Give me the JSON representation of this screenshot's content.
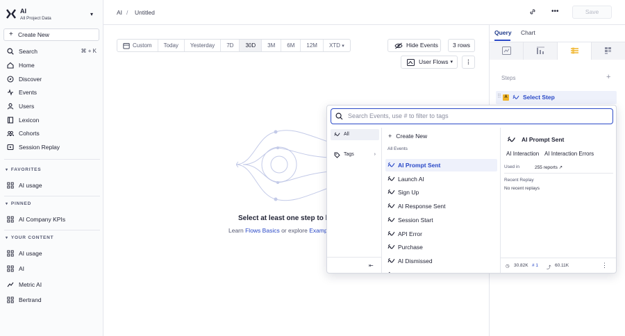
{
  "project": {
    "name": "AI",
    "subtitle": "All Project Data"
  },
  "sidebar": {
    "create_label": "Create New",
    "nav": [
      {
        "label": "Search",
        "shortcut": "⌘ + K",
        "icon": "search-icon"
      },
      {
        "label": "Home",
        "icon": "home-icon"
      },
      {
        "label": "Discover",
        "icon": "compass-icon"
      },
      {
        "label": "Events",
        "icon": "events-icon"
      },
      {
        "label": "Users",
        "icon": "users-icon"
      },
      {
        "label": "Lexicon",
        "icon": "book-icon"
      },
      {
        "label": "Cohorts",
        "icon": "cohorts-icon"
      },
      {
        "label": "Session Replay",
        "icon": "replay-icon"
      }
    ],
    "favorites": {
      "header": "FAVORITES",
      "items": [
        "AI usage"
      ]
    },
    "pinned": {
      "header": "PINNED",
      "items": [
        "AI Company KPIs"
      ]
    },
    "your_content": {
      "header": "YOUR CONTENT",
      "items": [
        "AI usage",
        "AI",
        "Metric AI",
        "Bertrand"
      ]
    }
  },
  "topbar": {
    "crumb_root": "AI",
    "crumb_sep": "/",
    "crumb_current": "Untitled",
    "save_label": "Save"
  },
  "timebar": {
    "segments": [
      "Custom",
      "Today",
      "Yesterday",
      "7D",
      "30D",
      "3M",
      "6M",
      "12M",
      "XTD"
    ],
    "active": "30D"
  },
  "controls": {
    "hide_events": "Hide Events",
    "rows": "3 rows",
    "flow_type": "User Flows"
  },
  "empty_state": {
    "title": "Select at least one step to beg",
    "learn": "Learn ",
    "basics_link": "Flows Basics",
    "or_explore": " or explore ",
    "examples_link": "Example"
  },
  "right_panel": {
    "tabs": [
      "Query",
      "Chart"
    ],
    "active_tab": "Query",
    "steps_label": "Steps",
    "step_select_label": "Select Step",
    "step_badge": "A"
  },
  "popover": {
    "search_placeholder": "Search Events, use # to filter to tags",
    "left": [
      {
        "label": "All"
      },
      {
        "label": "Tags"
      }
    ],
    "create_new": "Create New",
    "section": "All Events",
    "events": [
      "AI Prompt Sent",
      "Launch AI",
      "Sign Up",
      "AI Response Sent",
      "Session Start",
      "API Error",
      "Purchase",
      "AI Dismissed",
      "User Feedback"
    ],
    "active_event": "AI Prompt Sent",
    "detail": {
      "title": "AI Prompt Sent",
      "tags": [
        "AI Interaction",
        "AI Interaction Errors"
      ],
      "used_in": "Used in",
      "reports": "255 reports ↗",
      "recent_replay": "Recent Replay",
      "no_replays": "No recent replays",
      "stat_volume": "30.82K",
      "stat_tag": "# 1",
      "stat_users": "60.11K"
    }
  },
  "colors": {
    "accent": "#2a49c7",
    "active_bg": "#eef1fb",
    "badge": "#f0b429"
  }
}
